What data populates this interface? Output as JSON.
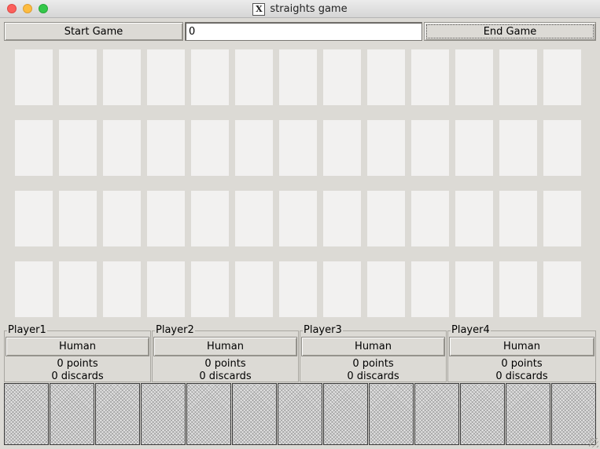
{
  "window": {
    "title": "straights game",
    "title_icon": "X"
  },
  "controls": {
    "start_label": "Start Game",
    "score_value": "0",
    "end_label": "End Game"
  },
  "table": {
    "rows": 4,
    "cols": 13
  },
  "players": [
    {
      "label": "Player1",
      "type": "Human",
      "points": "0 points",
      "discards": "0 discards"
    },
    {
      "label": "Player2",
      "type": "Human",
      "points": "0 points",
      "discards": "0 discards"
    },
    {
      "label": "Player3",
      "type": "Human",
      "points": "0 points",
      "discards": "0 discards"
    },
    {
      "label": "Player4",
      "type": "Human",
      "points": "0 points",
      "discards": "0 discards"
    }
  ],
  "hand": {
    "count": 13
  }
}
